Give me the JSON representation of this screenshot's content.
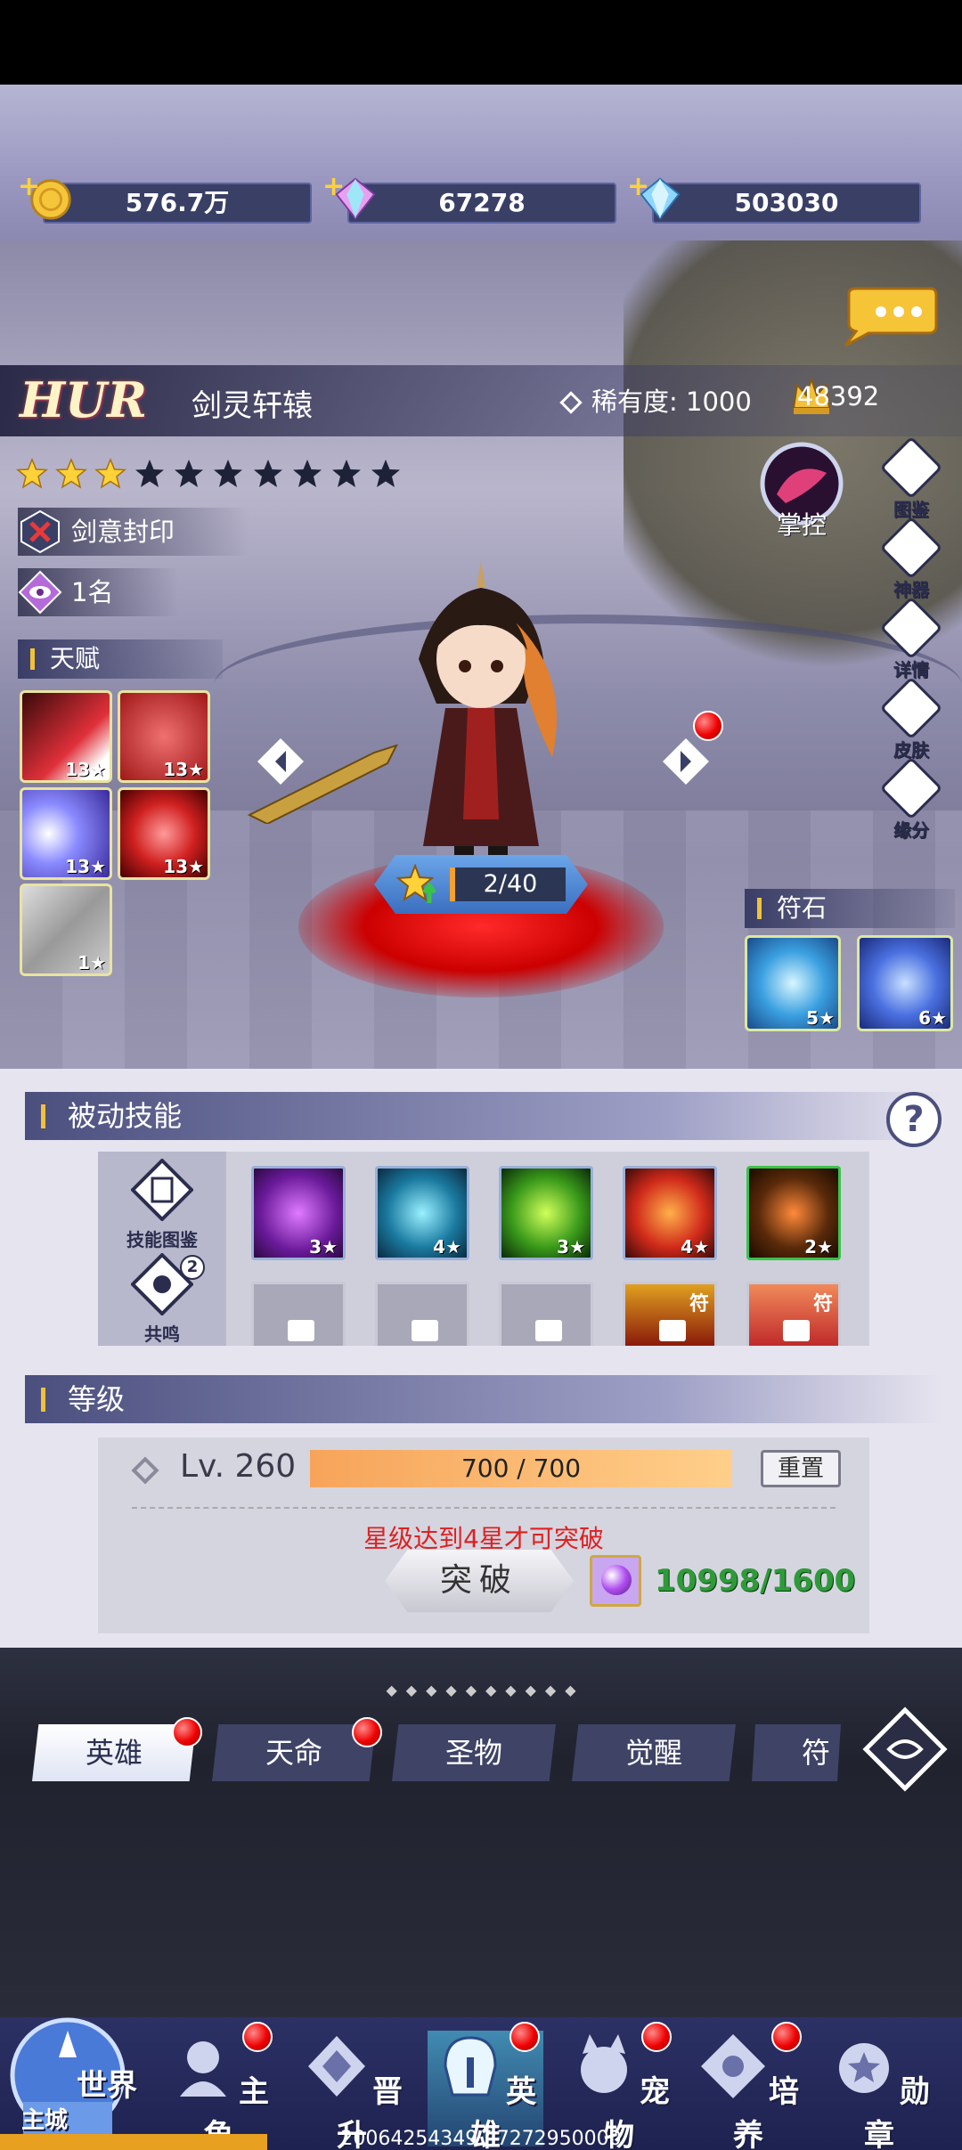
{
  "resources": [
    {
      "icon": "gold-coin-icon",
      "value": "576.7万"
    },
    {
      "icon": "rainbow-diamond-icon",
      "value": "67278"
    },
    {
      "icon": "blue-diamond-icon",
      "value": "503030"
    }
  ],
  "hero": {
    "rank": "HUR",
    "name": "剑灵轩辕",
    "rarity_label": "稀有度:",
    "rarity_value": "1000",
    "power": "48392",
    "stars_filled": 3,
    "stars_total": 10,
    "seal_label": "剑意封印",
    "rank_position": "1名",
    "control_label": "掌控",
    "star_progress": "2/40"
  },
  "talent": {
    "label": "天赋",
    "levels": [
      "13",
      "13",
      "13",
      "13",
      "1"
    ]
  },
  "side_menu": [
    "图鉴",
    "神器",
    "详情",
    "皮肤",
    "缘分"
  ],
  "runes": {
    "label": "符石",
    "levels": [
      "5",
      "6"
    ]
  },
  "passive": {
    "title": "被动技能",
    "help": "?",
    "book_label": "技能图鉴",
    "resonance_label": "共鸣",
    "resonance_count": "2",
    "skill_levels": [
      "3",
      "4",
      "3",
      "4",
      "2"
    ],
    "tag_label": "符"
  },
  "level": {
    "title": "等级",
    "lv_text": "Lv. 260",
    "exp_text": "700 / 700",
    "exp_ratio": 1.0,
    "reset_label": "重置",
    "warning": "星级达到4星才可突破",
    "break_label": "突破",
    "orb_count": "10998/1600"
  },
  "tabs": [
    "英雄",
    "天命",
    "圣物",
    "觉醒",
    "符文"
  ],
  "bottom_nav": {
    "world_label": "世界",
    "city_label": "主城",
    "items": [
      "主角",
      "晋升",
      "英雄",
      "宠物",
      "培养",
      "勋章"
    ]
  },
  "footer_text": "20064254349 / 7272950000"
}
